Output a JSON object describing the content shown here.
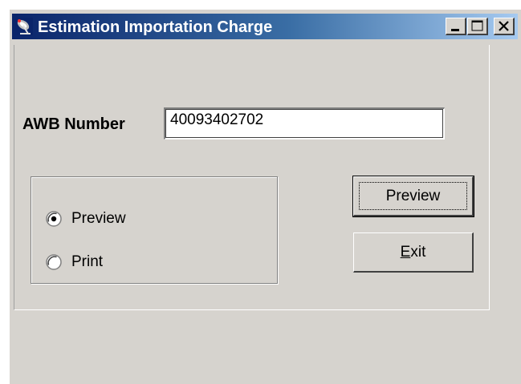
{
  "window": {
    "title": "Estimation Importation Charge",
    "controls": [
      "minimize",
      "maximize",
      "close"
    ],
    "icon": "satellite-dish-icon"
  },
  "form": {
    "awb_label": "AWB Number",
    "awb_value": "40093402702"
  },
  "output_options": {
    "selected": "Preview",
    "options": [
      {
        "label": "Preview",
        "checked": true
      },
      {
        "label": "Print",
        "checked": false
      }
    ]
  },
  "buttons": {
    "preview_label": "Preview",
    "exit_label": "Exit"
  },
  "colors": {
    "titlebar_start": "#0a246a",
    "titlebar_end": "#a6caf0",
    "face": "#d6d3ce"
  }
}
